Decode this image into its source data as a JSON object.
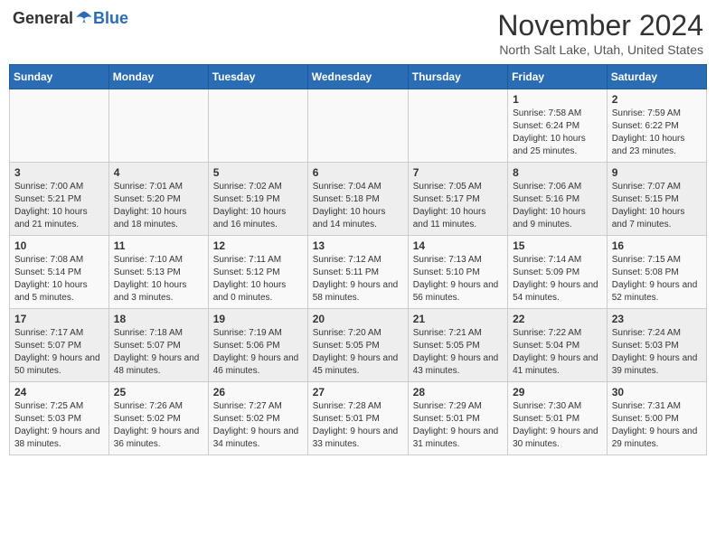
{
  "header": {
    "logo_general": "General",
    "logo_blue": "Blue",
    "month_title": "November 2024",
    "location": "North Salt Lake, Utah, United States"
  },
  "days_of_week": [
    "Sunday",
    "Monday",
    "Tuesday",
    "Wednesday",
    "Thursday",
    "Friday",
    "Saturday"
  ],
  "weeks": [
    [
      {
        "day": "",
        "info": ""
      },
      {
        "day": "",
        "info": ""
      },
      {
        "day": "",
        "info": ""
      },
      {
        "day": "",
        "info": ""
      },
      {
        "day": "",
        "info": ""
      },
      {
        "day": "1",
        "info": "Sunrise: 7:58 AM\nSunset: 6:24 PM\nDaylight: 10 hours and 25 minutes."
      },
      {
        "day": "2",
        "info": "Sunrise: 7:59 AM\nSunset: 6:22 PM\nDaylight: 10 hours and 23 minutes."
      }
    ],
    [
      {
        "day": "3",
        "info": "Sunrise: 7:00 AM\nSunset: 5:21 PM\nDaylight: 10 hours and 21 minutes."
      },
      {
        "day": "4",
        "info": "Sunrise: 7:01 AM\nSunset: 5:20 PM\nDaylight: 10 hours and 18 minutes."
      },
      {
        "day": "5",
        "info": "Sunrise: 7:02 AM\nSunset: 5:19 PM\nDaylight: 10 hours and 16 minutes."
      },
      {
        "day": "6",
        "info": "Sunrise: 7:04 AM\nSunset: 5:18 PM\nDaylight: 10 hours and 14 minutes."
      },
      {
        "day": "7",
        "info": "Sunrise: 7:05 AM\nSunset: 5:17 PM\nDaylight: 10 hours and 11 minutes."
      },
      {
        "day": "8",
        "info": "Sunrise: 7:06 AM\nSunset: 5:16 PM\nDaylight: 10 hours and 9 minutes."
      },
      {
        "day": "9",
        "info": "Sunrise: 7:07 AM\nSunset: 5:15 PM\nDaylight: 10 hours and 7 minutes."
      }
    ],
    [
      {
        "day": "10",
        "info": "Sunrise: 7:08 AM\nSunset: 5:14 PM\nDaylight: 10 hours and 5 minutes."
      },
      {
        "day": "11",
        "info": "Sunrise: 7:10 AM\nSunset: 5:13 PM\nDaylight: 10 hours and 3 minutes."
      },
      {
        "day": "12",
        "info": "Sunrise: 7:11 AM\nSunset: 5:12 PM\nDaylight: 10 hours and 0 minutes."
      },
      {
        "day": "13",
        "info": "Sunrise: 7:12 AM\nSunset: 5:11 PM\nDaylight: 9 hours and 58 minutes."
      },
      {
        "day": "14",
        "info": "Sunrise: 7:13 AM\nSunset: 5:10 PM\nDaylight: 9 hours and 56 minutes."
      },
      {
        "day": "15",
        "info": "Sunrise: 7:14 AM\nSunset: 5:09 PM\nDaylight: 9 hours and 54 minutes."
      },
      {
        "day": "16",
        "info": "Sunrise: 7:15 AM\nSunset: 5:08 PM\nDaylight: 9 hours and 52 minutes."
      }
    ],
    [
      {
        "day": "17",
        "info": "Sunrise: 7:17 AM\nSunset: 5:07 PM\nDaylight: 9 hours and 50 minutes."
      },
      {
        "day": "18",
        "info": "Sunrise: 7:18 AM\nSunset: 5:07 PM\nDaylight: 9 hours and 48 minutes."
      },
      {
        "day": "19",
        "info": "Sunrise: 7:19 AM\nSunset: 5:06 PM\nDaylight: 9 hours and 46 minutes."
      },
      {
        "day": "20",
        "info": "Sunrise: 7:20 AM\nSunset: 5:05 PM\nDaylight: 9 hours and 45 minutes."
      },
      {
        "day": "21",
        "info": "Sunrise: 7:21 AM\nSunset: 5:05 PM\nDaylight: 9 hours and 43 minutes."
      },
      {
        "day": "22",
        "info": "Sunrise: 7:22 AM\nSunset: 5:04 PM\nDaylight: 9 hours and 41 minutes."
      },
      {
        "day": "23",
        "info": "Sunrise: 7:24 AM\nSunset: 5:03 PM\nDaylight: 9 hours and 39 minutes."
      }
    ],
    [
      {
        "day": "24",
        "info": "Sunrise: 7:25 AM\nSunset: 5:03 PM\nDaylight: 9 hours and 38 minutes."
      },
      {
        "day": "25",
        "info": "Sunrise: 7:26 AM\nSunset: 5:02 PM\nDaylight: 9 hours and 36 minutes."
      },
      {
        "day": "26",
        "info": "Sunrise: 7:27 AM\nSunset: 5:02 PM\nDaylight: 9 hours and 34 minutes."
      },
      {
        "day": "27",
        "info": "Sunrise: 7:28 AM\nSunset: 5:01 PM\nDaylight: 9 hours and 33 minutes."
      },
      {
        "day": "28",
        "info": "Sunrise: 7:29 AM\nSunset: 5:01 PM\nDaylight: 9 hours and 31 minutes."
      },
      {
        "day": "29",
        "info": "Sunrise: 7:30 AM\nSunset: 5:01 PM\nDaylight: 9 hours and 30 minutes."
      },
      {
        "day": "30",
        "info": "Sunrise: 7:31 AM\nSunset: 5:00 PM\nDaylight: 9 hours and 29 minutes."
      }
    ]
  ]
}
